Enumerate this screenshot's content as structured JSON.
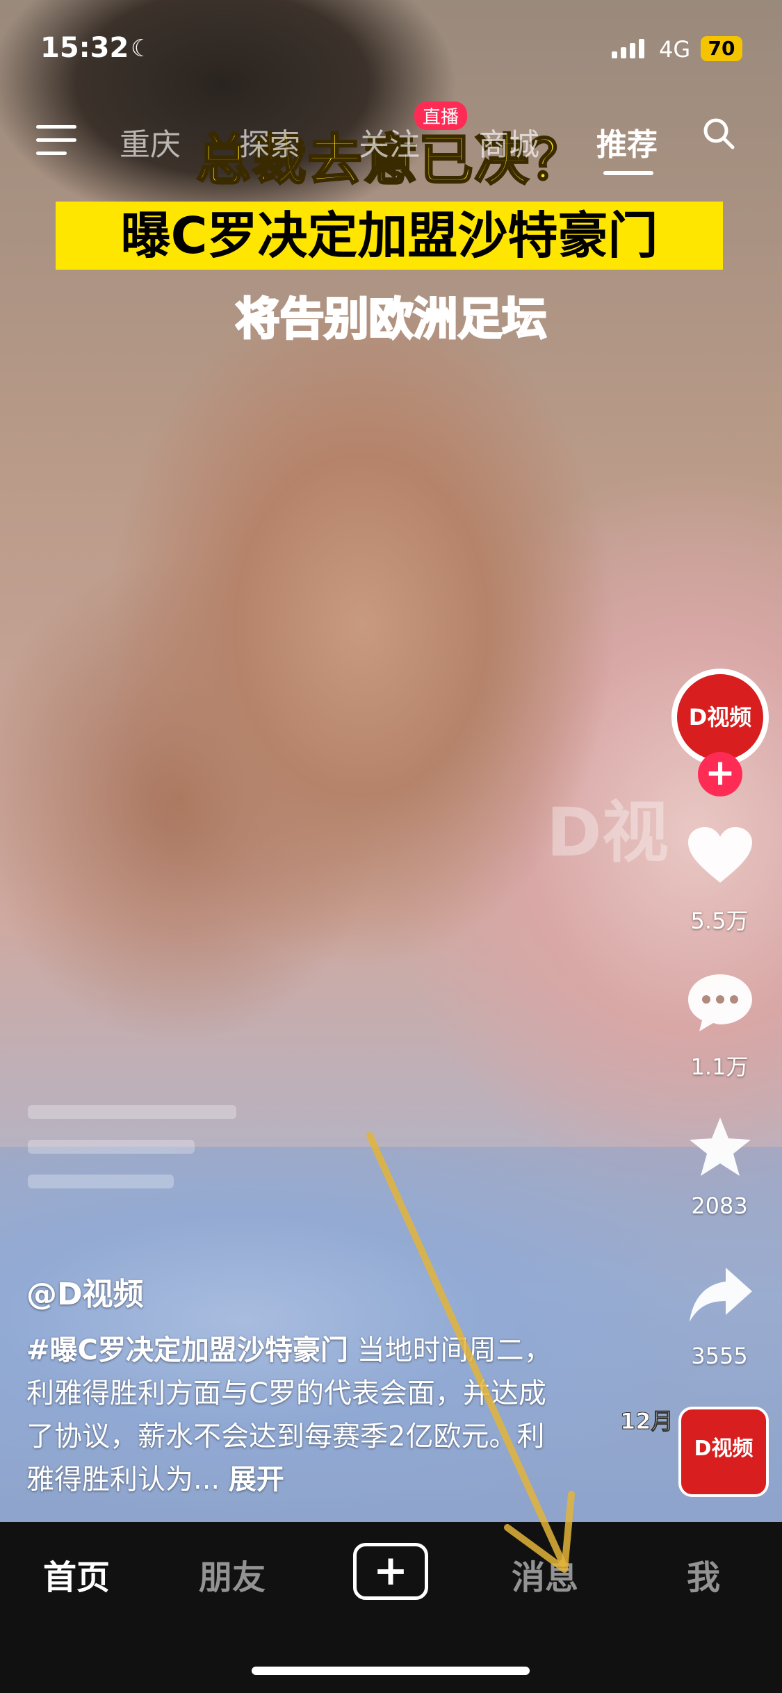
{
  "status_bar": {
    "time": "15:32",
    "network": "4G",
    "battery": "70"
  },
  "top_nav": {
    "tabs": [
      "重庆",
      "探索",
      "关注",
      "商城",
      "推荐"
    ],
    "live_badge": "直播"
  },
  "video": {
    "headline_1": "总裁去意已决？",
    "headline_2": "曝C罗决定加盟沙特豪门",
    "headline_3": "将告别欧洲足坛",
    "watermark": "D视",
    "date_stamp": "12月"
  },
  "right_rail": {
    "avatar_label": "D视频",
    "likes": "5.5万",
    "comments": "1.1万",
    "favorites": "2083",
    "shares": "3555",
    "music_label": "D视频"
  },
  "post": {
    "author": "@D视频",
    "hashtag": "#曝C罗决定加盟沙特豪门",
    "text": " 当地时间周二，利雅得胜利方面与C罗的代表会面，并达成了协议，薪水不会达到每赛季2亿欧元。利雅得胜利认为...",
    "expand": "展开"
  },
  "bottom_nav": {
    "home": "首页",
    "friends": "朋友",
    "create": "+",
    "messages": "消息",
    "me": "我"
  },
  "colors": {
    "accent": "#fe2c55",
    "headline_yellow": "#ffe11a",
    "headline_red": "#e01414",
    "brand_red": "#d81e1e",
    "battery": "#f5c400",
    "arrow": "#e3b43a"
  }
}
